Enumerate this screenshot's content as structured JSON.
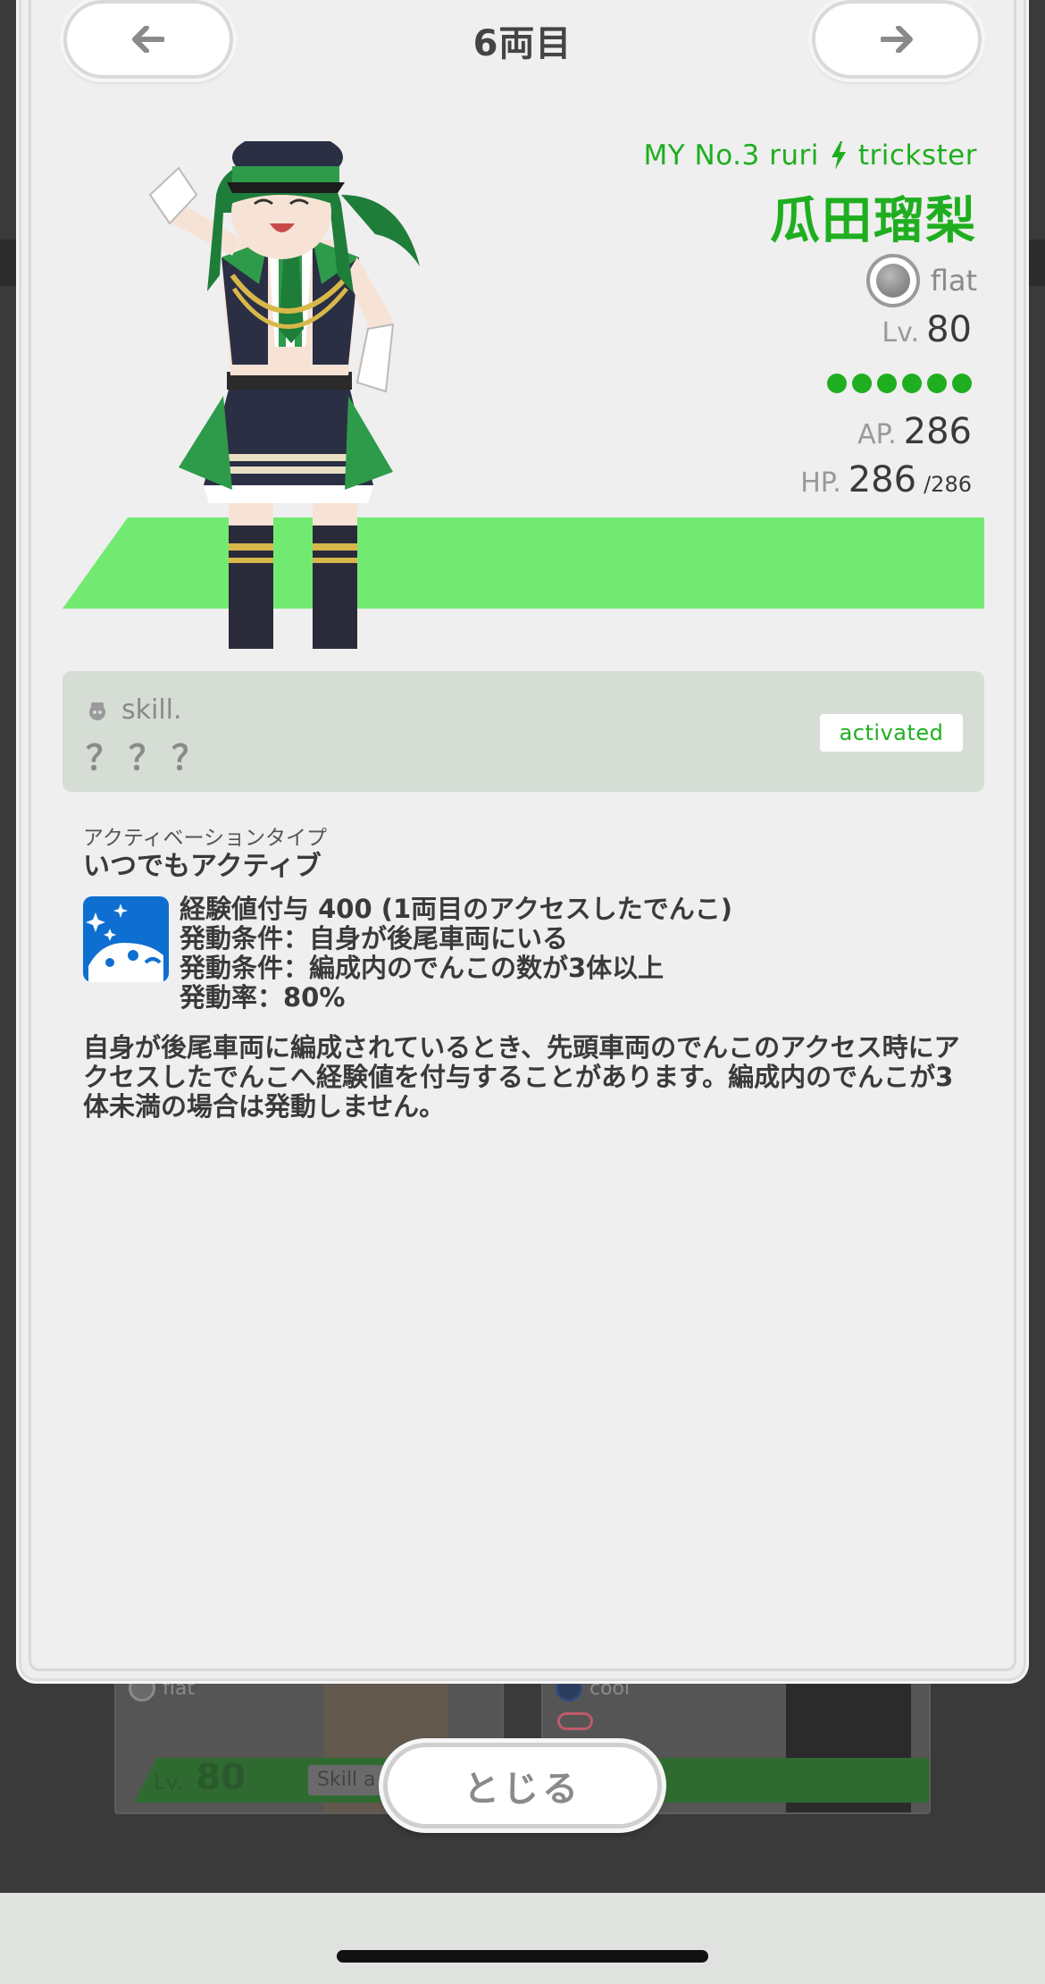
{
  "modal": {
    "title": "6両目",
    "prev_icon": "arrow-left-icon",
    "next_icon": "arrow-right-icon"
  },
  "character": {
    "number": "MY No.3 ruri",
    "type": "trickster",
    "type_icon": "lightning-icon",
    "name": "瓜田瑠梨",
    "attribute": "flat",
    "attribute_icon": "flat-attribute-icon",
    "lv_label": "Lv.",
    "lv": "80",
    "rarity_dots": 6,
    "ap_label": "AP.",
    "ap": "286",
    "hp_label": "HP.",
    "hp": "286",
    "hp_max": "/286"
  },
  "skill": {
    "label": "skill.",
    "name": "？？？",
    "status": "activated"
  },
  "activation": {
    "caption": "アクティベーションタイプ",
    "value": "いつでもアクティブ"
  },
  "effects": [
    "経験値付与 400 (1両目のアクセスしたでんこ)",
    "発動条件：自身が後尾車両にいる",
    "発動条件：編成内のでんこの数が3体以上",
    "発動率：80%"
  ],
  "description": "自身が後尾車両に編成されているとき、先頭車両のでんこのアクセス時にアクセスしたでんこへ経験値を付与することがあります。編成内のでんこが3体未満の場合は発動しません。",
  "background": {
    "left_card": {
      "attribute": "flat",
      "lv_label": "Lv.",
      "lv": "80",
      "skill_tag": "Skill a"
    },
    "right_card": {
      "attribute": "cool"
    }
  },
  "close_label": "とじる",
  "colors": {
    "accent_green": "#1fae1f",
    "stripe_green": "#72ea72",
    "skill_box": "#d5ddd5",
    "effect_icon_blue": "#0e6fd0"
  }
}
